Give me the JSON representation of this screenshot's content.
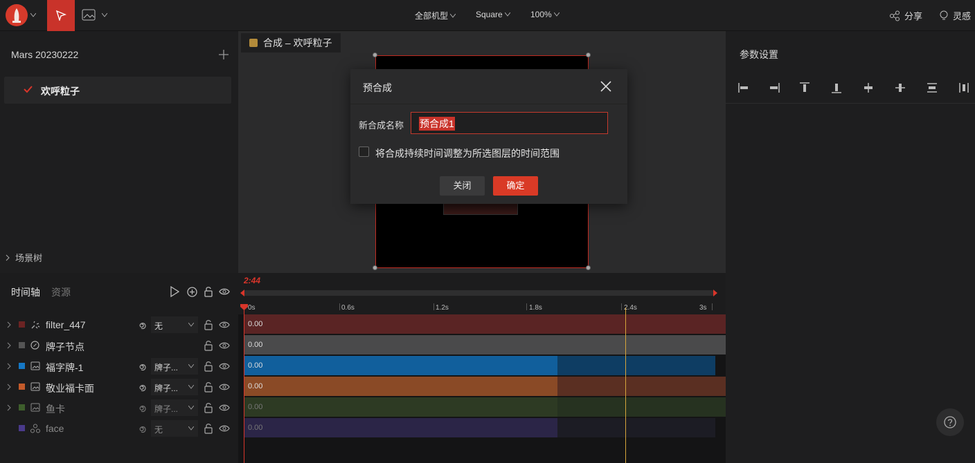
{
  "topbar": {
    "center": [
      "全部机型",
      "Square",
      "100%"
    ],
    "share": "分享",
    "inspiration": "灵感"
  },
  "left": {
    "project_title": "Mars 20230222",
    "comp_item": "欢呼粒子",
    "scene_tree": "场景树"
  },
  "viewport": {
    "tab": "合成 – 欢呼粒子"
  },
  "right": {
    "title": "参数设置"
  },
  "timeline": {
    "tabs": [
      "时间轴",
      "资源"
    ],
    "time": "2:44",
    "ticks": [
      "0s",
      "0.6s",
      "1.2s",
      "1.8s",
      "2.4s",
      "3s"
    ],
    "layers": [
      {
        "name": "filter_447",
        "color": "#6b2323",
        "parent": "无",
        "track_color": "#5a2424",
        "track_dark": "#5a2424",
        "split": 1.0,
        "val": "0.00",
        "dim": false
      },
      {
        "name": "牌子节点",
        "color": "#555555",
        "parent": "",
        "track_color": "#4a4a4b",
        "track_dark": "#4a4a4b",
        "split": 1.0,
        "val": "0.00",
        "dim": false
      },
      {
        "name": "福字牌-1",
        "color": "#1577c4",
        "parent": "牌子...",
        "track_color": "#115f9c",
        "track_dark": "#0e3d63",
        "split": 0.65,
        "val": "0.00",
        "dim": false
      },
      {
        "name": "敬业福卡面",
        "color": "#c35a2a",
        "parent": "牌子...",
        "track_color": "#8a4a26",
        "track_dark": "#5a2f22",
        "split": 0.65,
        "val": "0.00",
        "dim": false
      },
      {
        "name": "鱼卡",
        "color": "#3e5e2c",
        "parent": "牌子...",
        "track_color": "#2d3a23",
        "track_dark": "#263220",
        "split": 0.65,
        "val": "0.00",
        "dim": true
      },
      {
        "name": "face",
        "color": "#4a3a8a",
        "parent": "无",
        "track_color": "#2b2547",
        "track_dark": "#1c1c24",
        "split": 0.65,
        "val": "0.00",
        "dim": true
      }
    ]
  },
  "dialog": {
    "title": "预合成",
    "name_label": "新合成名称",
    "name_value": "预合成1",
    "checkbox_label": "将合成持续时间调整为所选图层的时间范围",
    "close_label": "关闭",
    "ok_label": "确定"
  }
}
